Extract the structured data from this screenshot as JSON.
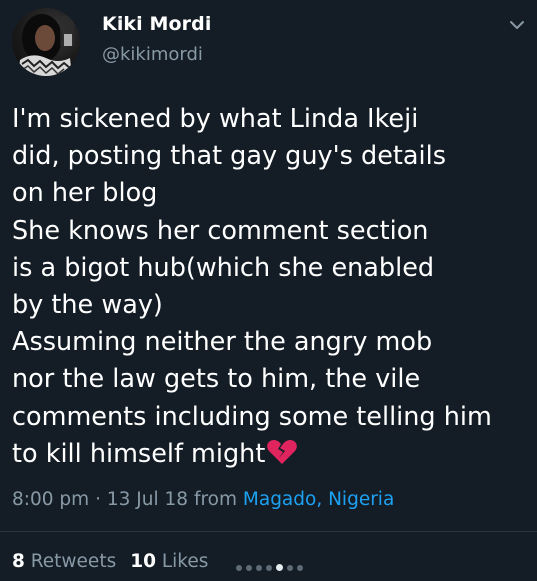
{
  "user": {
    "display_name": "Kiki Mordi",
    "handle": "@kikimordi"
  },
  "tweet": {
    "lines": [
      "I'm sickened by what Linda Ikeji",
      "did, posting that gay guy's details",
      "on her blog",
      "She knows her comment section",
      "is a bigot hub(which she enabled",
      "by the way)",
      "Assuming neither the angry mob",
      "nor the law gets to him, the vile",
      "comments including some telling him",
      "to kill himself might"
    ],
    "emoji": "broken-heart-icon"
  },
  "meta": {
    "time": "8:00 pm",
    "separator": "·",
    "date": "13 Jul 18",
    "from_label": "from",
    "location": "Magado, Nigeria"
  },
  "stats": {
    "retweets_count": "8",
    "retweets_label": "Retweets",
    "likes_count": "10",
    "likes_label": "Likes"
  },
  "pagination": {
    "total": 7,
    "active_index": 4
  },
  "colors": {
    "background": "#141d26",
    "text": "#ffffff",
    "secondary": "#8899a6",
    "link": "#1da1f2",
    "heart": "#e0245e"
  }
}
